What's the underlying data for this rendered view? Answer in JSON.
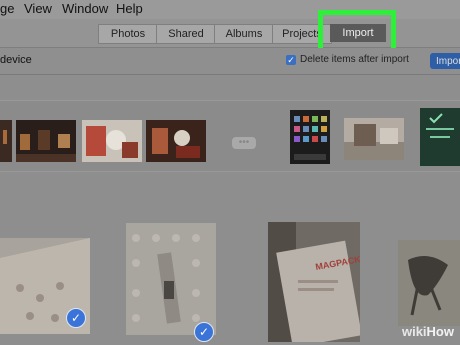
{
  "menu": [
    "ge",
    "View",
    "Window",
    "Help"
  ],
  "tabs": [
    {
      "label": "Photos"
    },
    {
      "label": "Shared"
    },
    {
      "label": "Albums"
    },
    {
      "label": "Projects"
    },
    {
      "label": "Import",
      "selected": true
    }
  ],
  "subbar": {
    "device_label": "device",
    "checkbox_label": "Delete items after import",
    "checkbox_checked": true,
    "import_button": "Impor"
  },
  "strip": {
    "more_label": "•••"
  },
  "watermark": {
    "wiki": "wiki",
    "how": "How"
  },
  "colors": {
    "highlight": "#2ef03a",
    "accent": "#3b74d8"
  }
}
